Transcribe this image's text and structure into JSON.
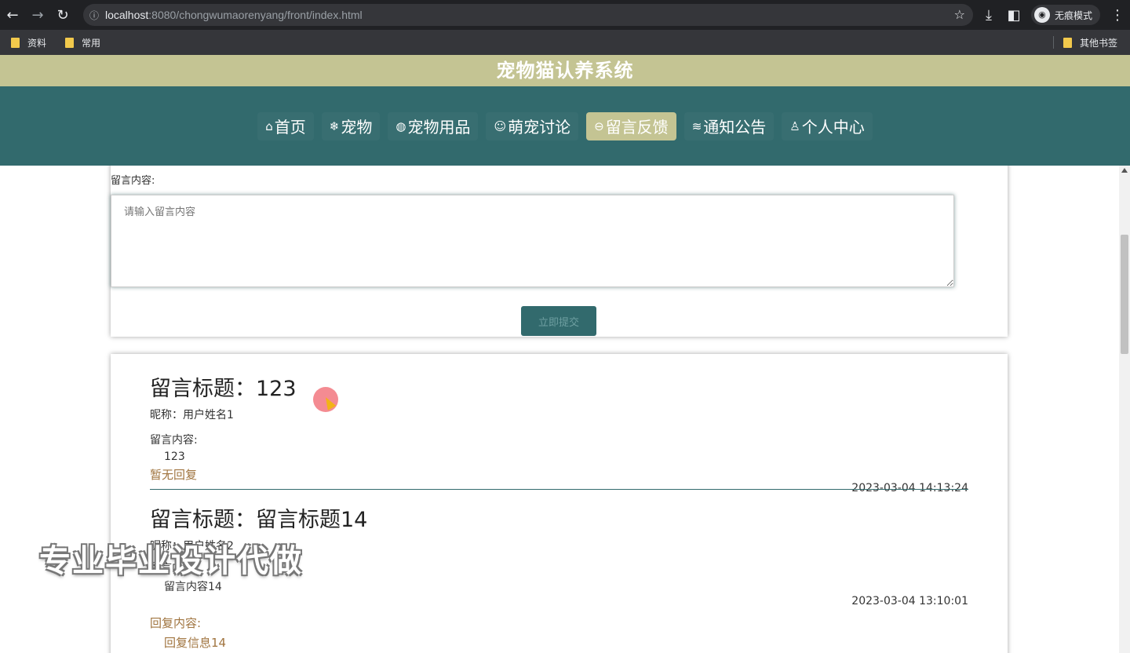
{
  "browser": {
    "url_host": "localhost",
    "url_path": ":8080/chongwumaorenyang/front/index.html",
    "incognito_label": "无痕模式",
    "bookmarks": [
      "资料",
      "常用"
    ],
    "other_bookmarks": "其他书签"
  },
  "site": {
    "title": "宠物猫认养系统",
    "nav": [
      {
        "icon": "⌂",
        "label": "首页"
      },
      {
        "icon": "❄",
        "label": "宠物"
      },
      {
        "icon": "◍",
        "label": "宠物用品"
      },
      {
        "icon": "☺",
        "label": "萌宠讨论"
      },
      {
        "icon": "⊖",
        "label": "留言反馈",
        "active": true
      },
      {
        "icon": "≋",
        "label": "通知公告"
      },
      {
        "icon": "♙",
        "label": "个人中心"
      }
    ]
  },
  "form": {
    "content_label": "留言内容:",
    "content_placeholder": "请输入留言内容",
    "submit_label": "立即提交"
  },
  "messages": [
    {
      "title": "留言标题：123",
      "nickname": "昵称：用户姓名1",
      "content_label": "留言内容:",
      "content": "123",
      "reply": "暂无回复",
      "time": "2023-03-04 14:13:24"
    },
    {
      "title": "留言标题：留言标题14",
      "nickname": "昵称：用户姓名2",
      "content_label": "留言内容:",
      "content": "留言内容14",
      "reply_label": "回复内容:",
      "reply": "回复信息14",
      "time": "2023-03-04 13:10:01"
    }
  ],
  "watermark": "专业毕业设计代做"
}
